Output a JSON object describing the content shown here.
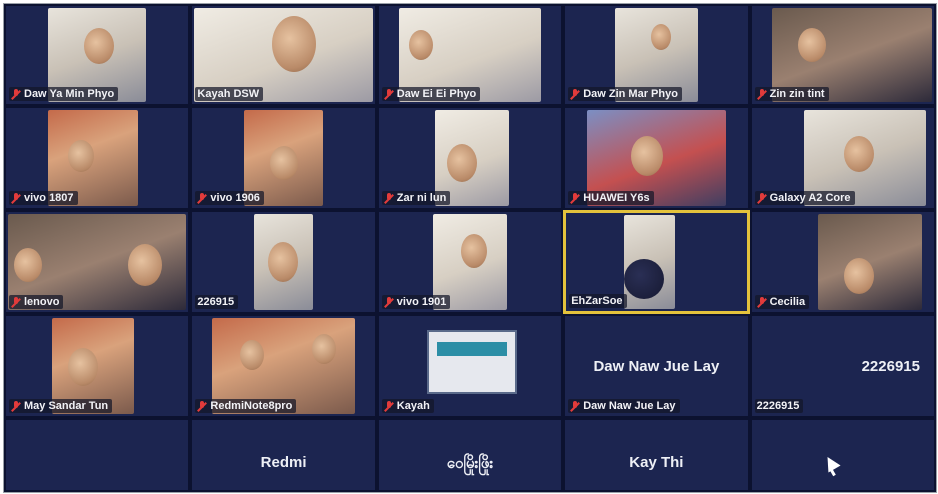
{
  "meeting": {
    "tiles": [
      {
        "name": "Daw Ya Min Phyo",
        "muted": true,
        "video": true
      },
      {
        "name": "Kayah DSW",
        "muted": false,
        "video": true
      },
      {
        "name": "Daw Ei Ei Phyo",
        "muted": true,
        "video": true
      },
      {
        "name": "Daw Zin Mar Phyo",
        "muted": true,
        "video": true
      },
      {
        "name": "Zin zin tint",
        "muted": true,
        "video": true
      },
      {
        "name": "vivo 1807",
        "muted": true,
        "video": true
      },
      {
        "name": "vivo 1906",
        "muted": true,
        "video": true
      },
      {
        "name": "Zar ni lun",
        "muted": true,
        "video": true
      },
      {
        "name": "HUAWEI Y6s",
        "muted": true,
        "video": true
      },
      {
        "name": "Galaxy A2 Core",
        "muted": true,
        "video": true
      },
      {
        "name": "lenovo",
        "muted": true,
        "video": true
      },
      {
        "name": "226915",
        "muted": false,
        "video": true
      },
      {
        "name": "vivo 1901",
        "muted": true,
        "video": true
      },
      {
        "name": "EhZarSoe",
        "muted": false,
        "video": true,
        "active_speaker": true
      },
      {
        "name": "Cecilia",
        "muted": true,
        "video": true
      },
      {
        "name": "May Sandar Tun",
        "muted": true,
        "video": true
      },
      {
        "name": "RedmiNote8pro",
        "muted": true,
        "video": true
      },
      {
        "name": "Kayah",
        "muted": true,
        "video": true
      },
      {
        "name": "Daw Naw Jue Lay",
        "muted": true,
        "video": false,
        "display_name": "Daw Naw Jue Lay"
      },
      {
        "name": "2226915",
        "muted": false,
        "video": false,
        "display_name": "2226915"
      },
      {
        "name": "",
        "video": false,
        "display_name": ""
      },
      {
        "name": "",
        "video": false,
        "display_name": "Redmi"
      },
      {
        "name": "",
        "video": false,
        "display_name": "ဝေမြိုးဖြိုး"
      },
      {
        "name": "",
        "video": false,
        "display_name": "Kay Thi"
      },
      {
        "name": "",
        "video": false,
        "display_name": ""
      }
    ]
  },
  "colors": {
    "background": "#0c1230",
    "tile": "#1c2550",
    "active_speaker_border": "#e3c23c",
    "muted_icon": "#e23b3b"
  },
  "icons": [
    "mic-muted-icon",
    "cursor-icon"
  ]
}
